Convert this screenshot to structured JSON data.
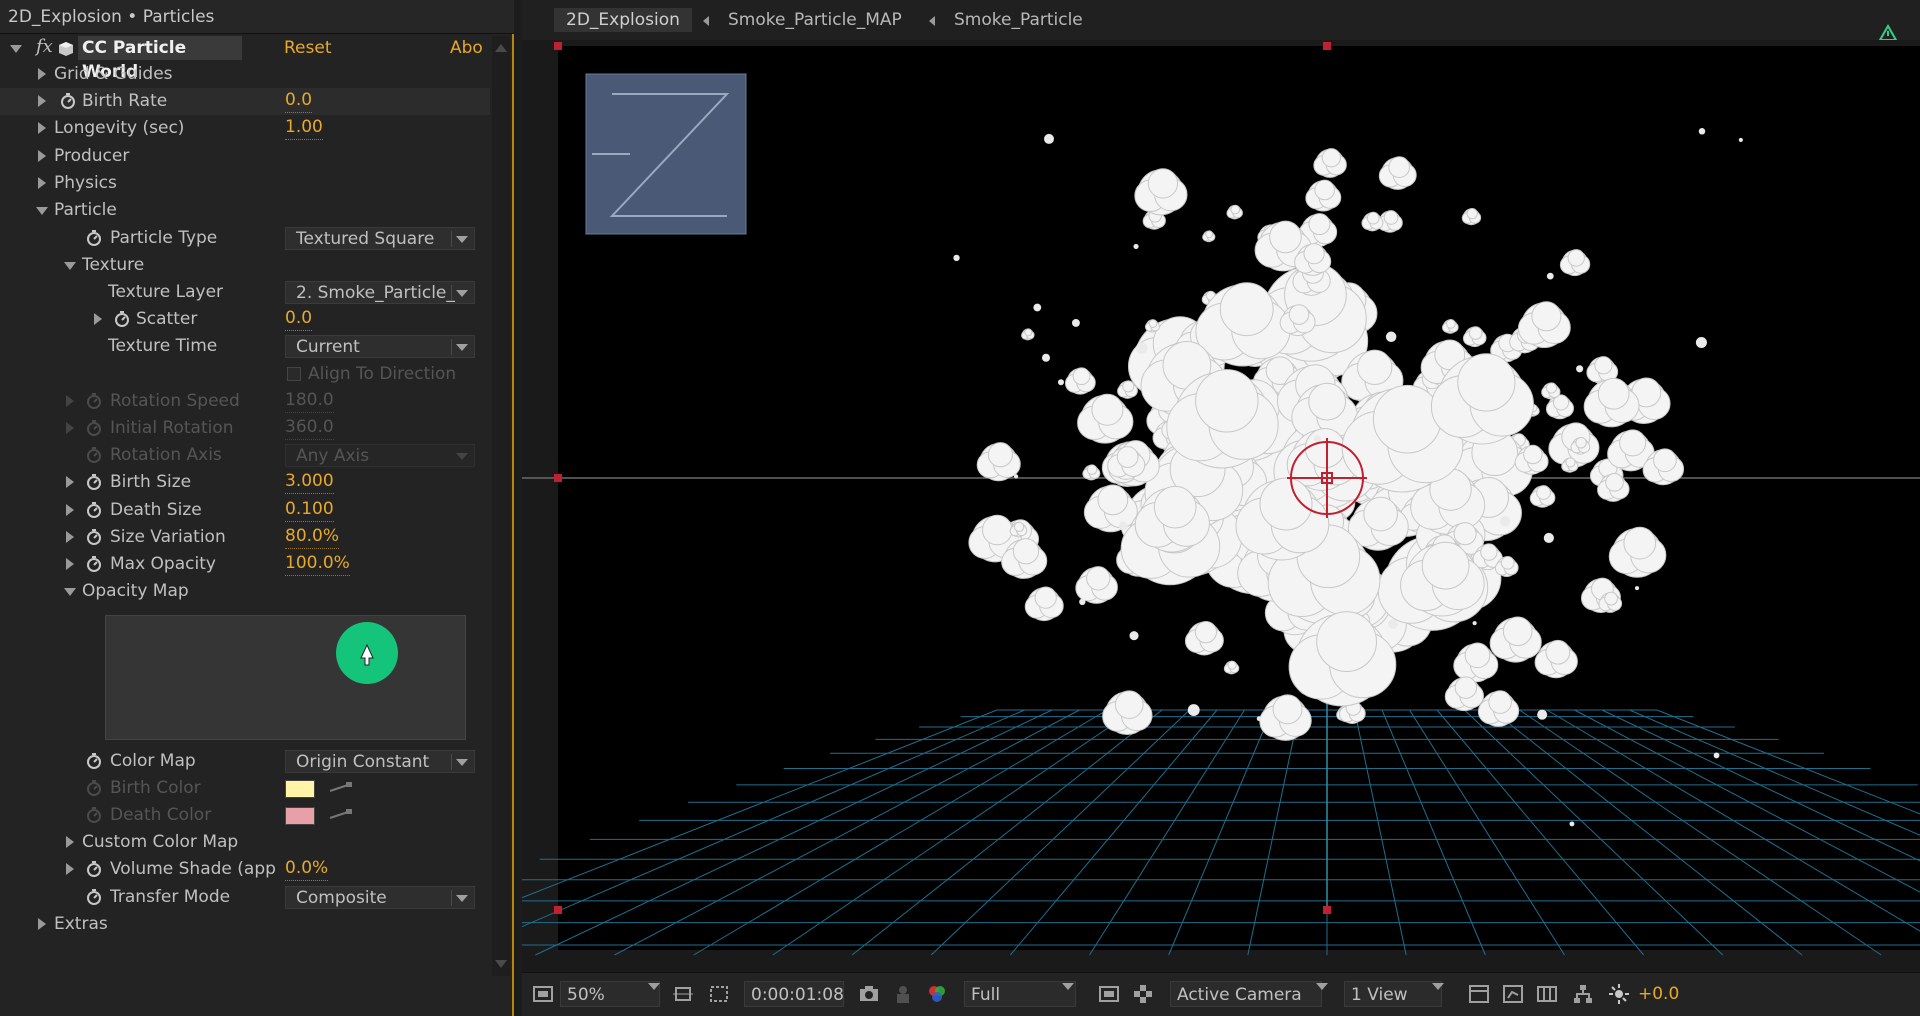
{
  "panel": {
    "title": "2D_Explosion • Particles",
    "effect_name": "CC Particle World",
    "reset_label": "Reset",
    "about_label": "Abo",
    "fx_label": "fx"
  },
  "properties": {
    "grid_guides": "Grid & Guides",
    "birth_rate_label": "Birth Rate",
    "birth_rate_value": "0.0",
    "longevity_label": "Longevity (sec)",
    "longevity_value": "1.00",
    "producer": "Producer",
    "physics": "Physics",
    "particle": "Particle",
    "particle_type_label": "Particle Type",
    "particle_type_value": "Textured Square",
    "texture": "Texture",
    "texture_layer_label": "Texture Layer",
    "texture_layer_value": "2. Smoke_Particle_",
    "scatter_label": "Scatter",
    "scatter_value": "0.0",
    "texture_time_label": "Texture Time",
    "texture_time_value": "Current",
    "align_label": "Align To Direction",
    "rotation_speed_label": "Rotation Speed",
    "rotation_speed_value": "180.0",
    "initial_rotation_label": "Initial Rotation",
    "initial_rotation_value": "360.0",
    "rotation_axis_label": "Rotation Axis",
    "rotation_axis_value": "Any Axis",
    "birth_size_label": "Birth Size",
    "birth_size_value": "3.000",
    "death_size_label": "Death Size",
    "death_size_value": "0.100",
    "size_variation_label": "Size Variation",
    "size_variation_value": "80.0%",
    "max_opacity_label": "Max Opacity",
    "max_opacity_value": "100.0%",
    "opacity_map_label": "Opacity Map",
    "color_map_label": "Color Map",
    "color_map_value": "Origin Constant",
    "birth_color_label": "Birth Color",
    "birth_color": "#fff4a8",
    "death_color_label": "Death Color",
    "death_color": "#e8a0a8",
    "custom_color_map": "Custom Color Map",
    "volume_shade_label": "Volume Shade (app",
    "volume_shade_value": "0.0%",
    "transfer_mode_label": "Transfer Mode",
    "transfer_mode_value": "Composite",
    "extras": "Extras"
  },
  "viewer": {
    "crumbs": [
      "2D_Explosion",
      "Smoke_Particle_MAP",
      "Smoke_Particle"
    ],
    "zoom": "50%",
    "timecode": "0:00:01:08",
    "resolution": "Full",
    "camera": "Active Camera",
    "views": "1 View",
    "exposure": "+0.0"
  },
  "colors": {
    "accent": "#e8a928",
    "opacity_dot": "#14c47a",
    "grid": "#1f6f8f"
  }
}
